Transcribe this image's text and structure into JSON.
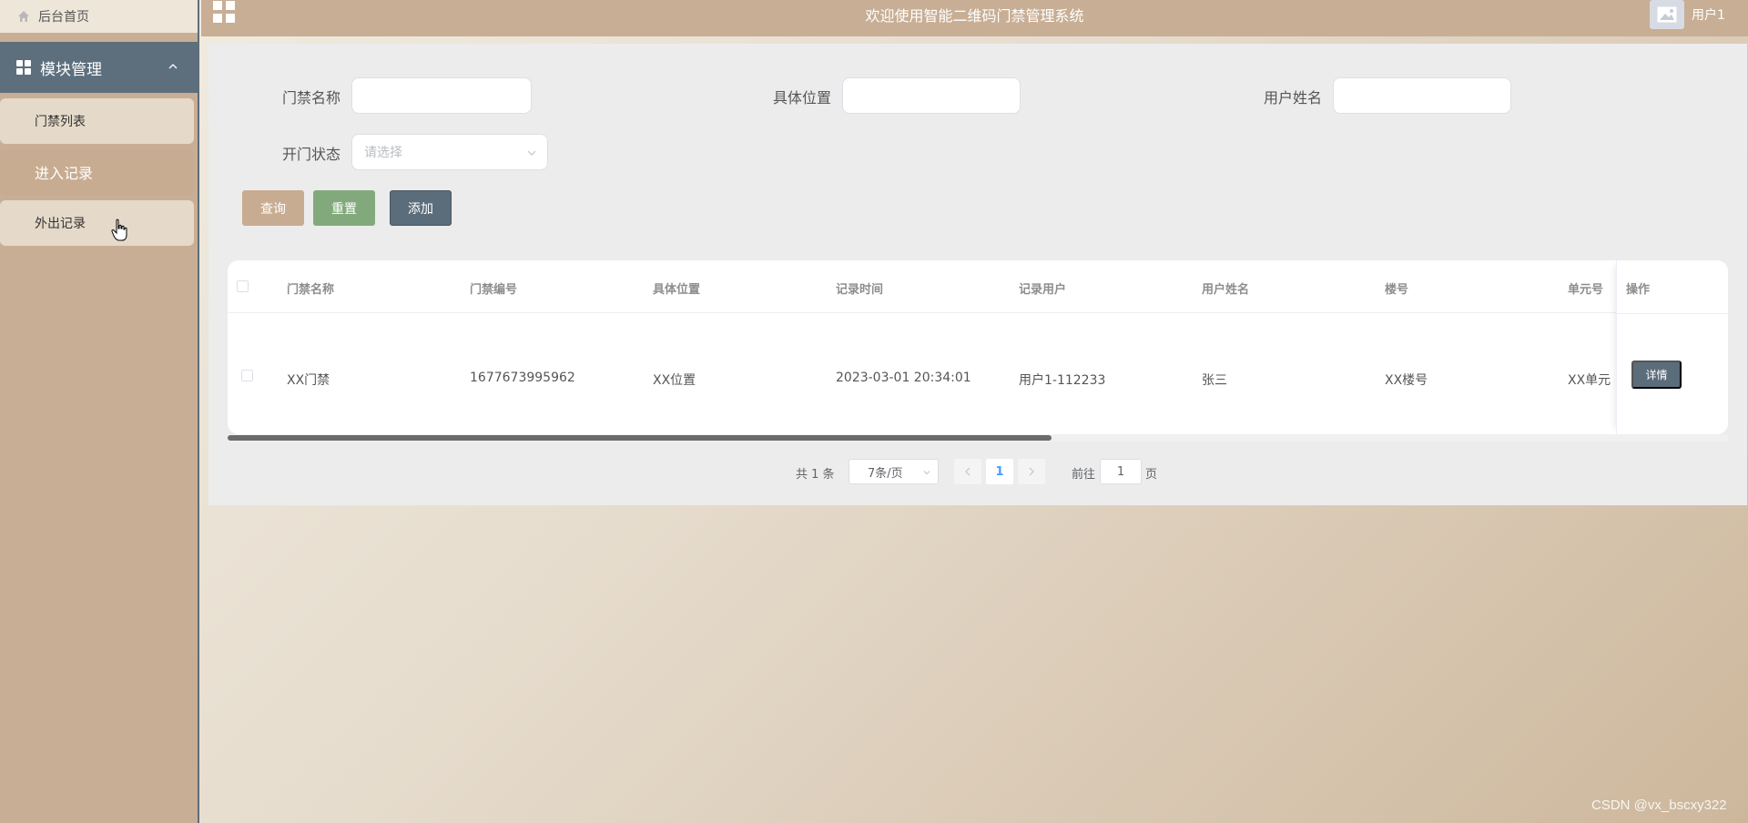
{
  "sidebar": {
    "home_label": "后台首页",
    "module_label": "模块管理",
    "items": [
      {
        "label": "门禁列表"
      },
      {
        "label": "进入记录"
      },
      {
        "label": "外出记录"
      }
    ]
  },
  "header": {
    "title": "欢迎使用智能二维码门禁管理系统",
    "user_name": "用户1"
  },
  "search": {
    "name_label": "门禁名称",
    "location_label": "具体位置",
    "username_label": "用户姓名",
    "status_label": "开门状态",
    "status_placeholder": "请选择",
    "name_value": "",
    "location_value": "",
    "username_value": ""
  },
  "buttons": {
    "query": "查询",
    "reset": "重置",
    "add": "添加"
  },
  "table": {
    "headers": [
      "门禁名称",
      "门禁编号",
      "具体位置",
      "记录时间",
      "记录用户",
      "用户姓名",
      "楼号",
      "单元号"
    ],
    "actions_header": "操作",
    "rows": [
      {
        "cells": [
          "XX门禁",
          "1677673995962",
          "XX位置",
          "2023-03-01 20:34:01",
          "用户1-112233",
          "张三",
          "XX楼号",
          "XX单元"
        ],
        "detail_label": "详情"
      }
    ]
  },
  "pagination": {
    "total": "共 1 条",
    "page_size": "7条/页",
    "current_page": "1",
    "goto_label": "前往",
    "goto_value": "1",
    "page_unit": "页"
  },
  "watermark": "CSDN @vx_bscxy322",
  "colors": {
    "accent": "#c8ae94",
    "module_bar": "#5d6f7d",
    "query_button": "#c8ac91",
    "reset_button": "#82a97c",
    "add_button": "#5b6c7b"
  }
}
